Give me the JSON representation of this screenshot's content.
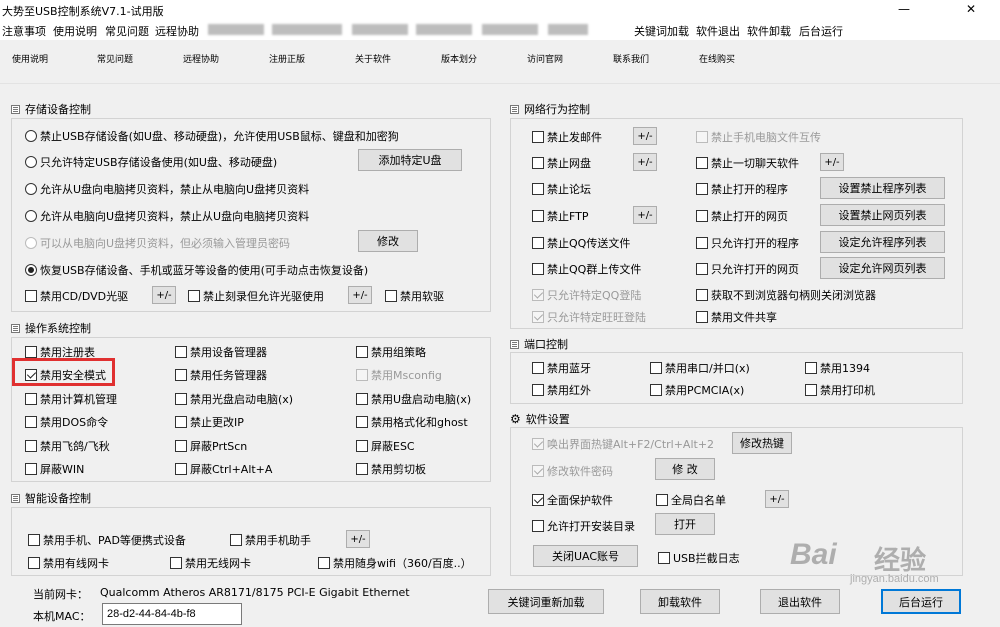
{
  "window": {
    "title": "大势至USB控制系统V7.1-试用版",
    "minimize_glyph": "—",
    "close_glyph": "✕"
  },
  "menu": {
    "items": [
      "注意事项",
      "使用说明",
      "常见问题",
      "远程协助"
    ],
    "right_items": [
      "关键词加载",
      "软件退出",
      "软件卸载",
      "后台运行"
    ]
  },
  "toolbar": {
    "items": [
      "使用说明",
      "常见问题",
      "远程协助",
      "注册正版",
      "关于软件",
      "版本划分",
      "访问官网",
      "联系我们",
      "在线购买"
    ]
  },
  "storage": {
    "title": "存储设备控制",
    "options": [
      {
        "label": "禁止USB存储设备(如U盘、移动硬盘)，允许使用USB鼠标、键盘和加密狗",
        "checked": false,
        "disabled": false
      },
      {
        "label": "只允许特定USB存储设备使用(如U盘、移动硬盘)",
        "checked": false,
        "disabled": false
      },
      {
        "label": "允许从U盘向电脑拷贝资料，禁止从电脑向U盘拷贝资料",
        "checked": false,
        "disabled": false
      },
      {
        "label": "允许从电脑向U盘拷贝资料，禁止从U盘向电脑拷贝资料",
        "checked": false,
        "disabled": false
      },
      {
        "label": "可以从电脑向U盘拷贝资料，但必须输入管理员密码",
        "checked": false,
        "disabled": true
      },
      {
        "label": "恢复USB存储设备、手机或蓝牙等设备的使用(可手动点击恢复设备)",
        "checked": true,
        "disabled": false
      }
    ],
    "add_button": "添加特定U盘",
    "modify_button": "修改",
    "cd_label": "禁用CD/DVD光驱",
    "burn_label": "禁止刻录但允许光驱使用",
    "floppy_label": "禁用软驱",
    "plusminus": "+/-"
  },
  "os": {
    "title": "操作系统控制",
    "items": [
      {
        "label": "禁用注册表",
        "checked": false,
        "disabled": false
      },
      {
        "label": "禁用设备管理器",
        "checked": false,
        "disabled": false
      },
      {
        "label": "禁用组策略",
        "checked": false,
        "disabled": false
      },
      {
        "label": "禁用安全模式",
        "checked": true,
        "disabled": false
      },
      {
        "label": "禁用任务管理器",
        "checked": false,
        "disabled": false
      },
      {
        "label": "禁用Msconfig",
        "checked": false,
        "disabled": true
      },
      {
        "label": "禁用计算机管理",
        "checked": false,
        "disabled": false
      },
      {
        "label": "禁用光盘启动电脑(x)",
        "checked": false,
        "disabled": false
      },
      {
        "label": "禁用U盘启动电脑(x)",
        "checked": false,
        "disabled": false
      },
      {
        "label": "禁用DOS命令",
        "checked": false,
        "disabled": false
      },
      {
        "label": "禁止更改IP",
        "checked": false,
        "disabled": false
      },
      {
        "label": "禁用格式化和ghost",
        "checked": false,
        "disabled": false
      },
      {
        "label": "禁用飞鸽/飞秋",
        "checked": false,
        "disabled": false
      },
      {
        "label": "屏蔽PrtScn",
        "checked": false,
        "disabled": false
      },
      {
        "label": "屏蔽ESC",
        "checked": false,
        "disabled": false
      },
      {
        "label": "屏蔽WIN",
        "checked": false,
        "disabled": false
      },
      {
        "label": "屏蔽Ctrl+Alt+A",
        "checked": false,
        "disabled": false
      },
      {
        "label": "禁用剪切板",
        "checked": false,
        "disabled": false
      }
    ]
  },
  "smart": {
    "title": "智能设备控制",
    "items": [
      {
        "label": "禁用手机、PAD等便携式设备",
        "checked": false
      },
      {
        "label": "禁用手机助手",
        "checked": false
      },
      {
        "label": "禁用有线网卡",
        "checked": false
      },
      {
        "label": "禁用无线网卡",
        "checked": false
      },
      {
        "label": "禁用随身wifi（360/百度..）",
        "checked": false
      }
    ],
    "plusminus": "+/-"
  },
  "network": {
    "title": "网络行为控制",
    "items": [
      {
        "label": "禁止发邮件",
        "checked": false,
        "disabled": false
      },
      {
        "label": "禁止手机电脑文件互传",
        "checked": false,
        "disabled": true
      },
      {
        "label": "禁止网盘",
        "checked": false,
        "disabled": false
      },
      {
        "label": "禁止一切聊天软件",
        "checked": false,
        "disabled": false
      },
      {
        "label": "禁止论坛",
        "checked": false,
        "disabled": false
      },
      {
        "label": "禁止打开的程序",
        "checked": false,
        "disabled": false
      },
      {
        "label": "禁止FTP",
        "checked": false,
        "disabled": false
      },
      {
        "label": "禁止打开的网页",
        "checked": false,
        "disabled": false
      },
      {
        "label": "禁止QQ传送文件",
        "checked": false,
        "disabled": false
      },
      {
        "label": "只允许打开的程序",
        "checked": false,
        "disabled": false
      },
      {
        "label": "禁止QQ群上传文件",
        "checked": false,
        "disabled": false
      },
      {
        "label": "只允许打开的网页",
        "checked": false,
        "disabled": false
      },
      {
        "label": "只允许特定QQ登陆",
        "checked": true,
        "disabled": true
      },
      {
        "label": "获取不到浏览器句柄则关闭浏览器",
        "checked": false,
        "disabled": false
      },
      {
        "label": "只允许特定旺旺登陆",
        "checked": true,
        "disabled": true
      },
      {
        "label": "禁用文件共享",
        "checked": false,
        "disabled": false
      }
    ],
    "buttons": [
      "设置禁止程序列表",
      "设置禁止网页列表",
      "设定允许程序列表",
      "设定允许网页列表"
    ],
    "plusminus": "+/-"
  },
  "ports": {
    "title": "端口控制",
    "items": [
      {
        "label": "禁用蓝牙",
        "checked": false
      },
      {
        "label": "禁用串口/并口(x)",
        "checked": false
      },
      {
        "label": "禁用1394",
        "checked": false
      },
      {
        "label": "禁用红外",
        "checked": false
      },
      {
        "label": "禁用PCMCIA(x)",
        "checked": false
      },
      {
        "label": "禁用打印机",
        "checked": false
      }
    ]
  },
  "settings": {
    "title": "软件设置",
    "hotkey_label": "唤出界面热键Alt+F2/Ctrl+Alt+2",
    "hotkey_button": "修改热键",
    "password_label": "修改软件密码",
    "password_button": "修 改",
    "protect_label": "全面保护软件",
    "whitelist_label": "全局白名单",
    "autostart_label": "允许打开安装目录",
    "open_button": "打开",
    "uac_button": "关闭UAC账号",
    "usb_log_label": "USB拦截日志",
    "plusminus": "+/-",
    "hotkey_checked": true,
    "password_checked": true,
    "protect_checked": true,
    "whitelist_checked": false,
    "autostart_checked": false,
    "usb_log_checked": false
  },
  "footer": {
    "nic_label": "当前网卡：",
    "nic_value": "Qualcomm Atheros AR8171/8175 PCI-E Gigabit Ethernet",
    "mac_label": "本机MAC：",
    "mac_value": "28-d2-44-84-4b-f8",
    "buttons": [
      "关键词重新加载",
      "卸载软件",
      "退出软件",
      "后台运行"
    ]
  },
  "watermark": {
    "brand": "Bai",
    "brand2": "经验",
    "url": "jingyan.baidu.com"
  }
}
